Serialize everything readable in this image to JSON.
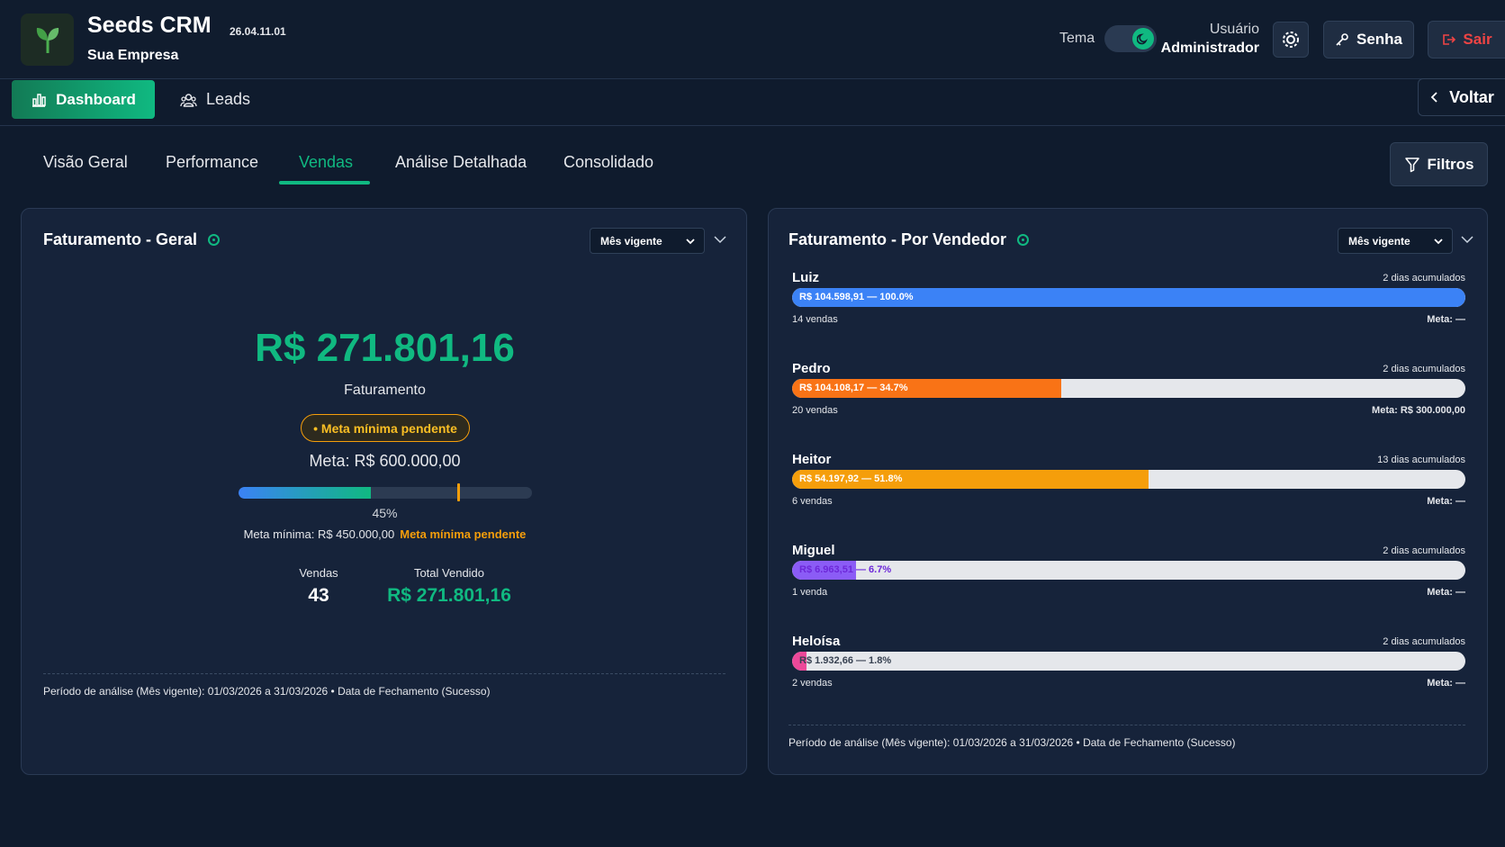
{
  "header": {
    "app_title": "Seeds CRM",
    "version": "26.04.11.01",
    "company": "Sua Empresa",
    "theme_label": "Tema",
    "user_label": "Usuário",
    "user_name": "Administrador",
    "senha_label": "Senha",
    "sair_label": "Sair"
  },
  "nav": {
    "dashboard_label": "Dashboard",
    "leads_label": "Leads",
    "voltar_label": "Voltar"
  },
  "subtabs": [
    "Visão Geral",
    "Performance",
    "Vendas",
    "Análise Detalhada",
    "Consolidado"
  ],
  "filters_label": "Filtros",
  "geral": {
    "title": "Faturamento - Geral",
    "period": "Mês vigente",
    "total": "R$ 271.801,16",
    "total_label": "Faturamento",
    "badge": "• Meta mínima pendente",
    "meta": "Meta: R$ 600.000,00",
    "progress": 0.45,
    "min_marker": 0.75,
    "progress_label": "45%",
    "meta_min": "Meta mínima: R$ 450.000,00",
    "meta_min_status": "Meta mínima pendente",
    "vendas_label": "Vendas",
    "vendas_value": "43",
    "total_vendido_label": "Total Vendido",
    "total_vendido_value": "R$ 271.801,16",
    "footnote": "Período de análise (Mês vigente): 01/03/2026 a 31/03/2026 • Data de Fechamento (Sucesso)"
  },
  "vendedor": {
    "title": "Faturamento - Por Vendedor",
    "period": "Mês vigente",
    "sellers": [
      {
        "name": "Luiz",
        "days": "2 dias acumulados",
        "bar_label": "R$ 104.598,91 — 100.0%",
        "pct": 1.0,
        "color": "#3b82f6",
        "sales": "14 vendas",
        "meta": "Meta: —"
      },
      {
        "name": "Pedro",
        "days": "2 dias acumulados",
        "bar_label": "R$ 104.108,17 — 34.7%",
        "pct": 0.4,
        "color": "#f97316",
        "sales": "20 vendas",
        "meta": "Meta: R$ 300.000,00"
      },
      {
        "name": "Heitor",
        "days": "13 dias acumulados",
        "bar_label": "R$ 54.197,92 — 51.8%",
        "pct": 0.53,
        "color": "#f59e0b",
        "sales": "6 vendas",
        "meta": "Meta: —"
      },
      {
        "name": "Miguel",
        "days": "2 dias acumulados",
        "bar_label": "R$ 6.963,51 — 6.7%",
        "pct": 0.095,
        "color": "#8b5cf6",
        "sales": "1 venda",
        "meta": "Meta: —"
      },
      {
        "name": "Heloísa",
        "days": "2 dias acumulados",
        "bar_label": "R$ 1.932,66 — 1.8%",
        "pct": 0.022,
        "color": "#ec4899",
        "sales": "2 vendas",
        "meta": "Meta: —"
      }
    ],
    "footnote": "Período de análise (Mês vigente): 01/03/2026 a 31/03/2026 • Data de Fechamento (Sucesso)"
  }
}
